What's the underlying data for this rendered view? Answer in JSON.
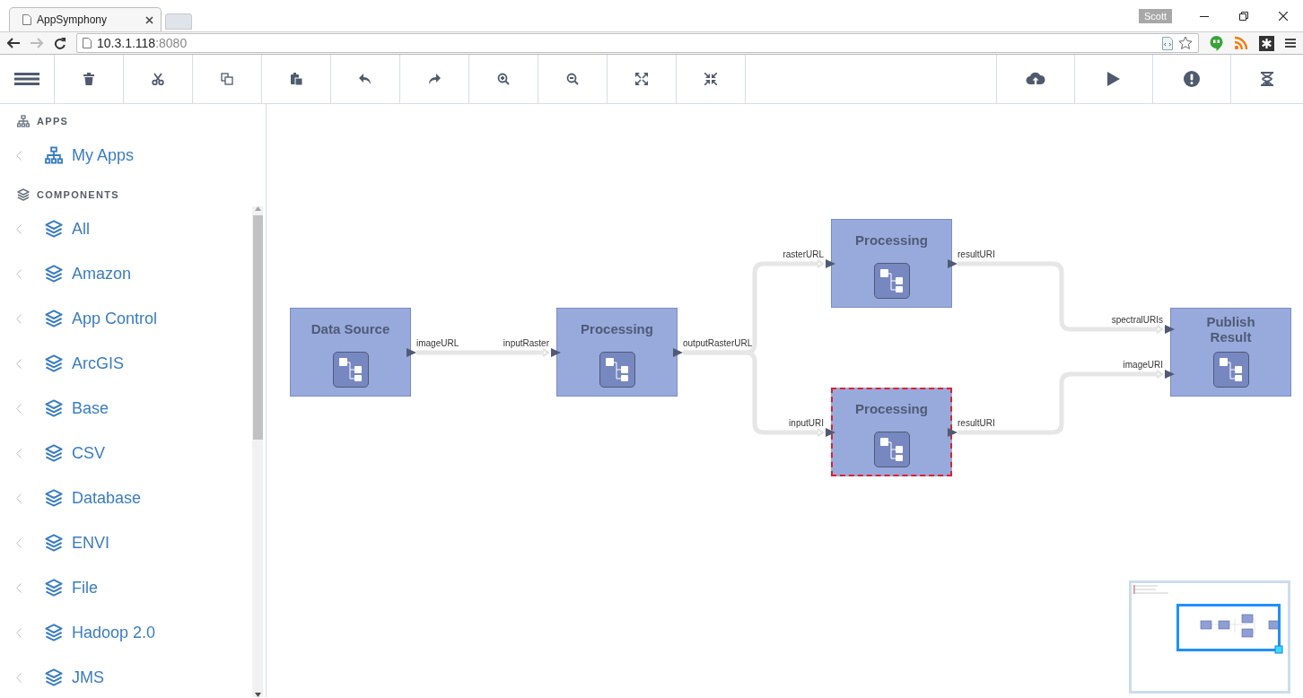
{
  "browser": {
    "tab_title": "AppSymphony",
    "url_host": "10.3.1.118",
    "url_port": ":8080",
    "profile": "Scott"
  },
  "sidebar": {
    "sections": [
      {
        "title": "APPS",
        "items": [
          {
            "label": "My Apps"
          }
        ]
      },
      {
        "title": "COMPONENTS",
        "items": [
          {
            "label": "All"
          },
          {
            "label": "Amazon"
          },
          {
            "label": "App Control"
          },
          {
            "label": "ArcGIS"
          },
          {
            "label": "Base"
          },
          {
            "label": "CSV"
          },
          {
            "label": "Database"
          },
          {
            "label": "ENVI"
          },
          {
            "label": "File"
          },
          {
            "label": "Hadoop 2.0"
          },
          {
            "label": "JMS"
          }
        ]
      }
    ]
  },
  "diagram": {
    "nodes": [
      {
        "title": "Data Source",
        "selected": false,
        "outputs": [
          "imageURL"
        ]
      },
      {
        "title": "Processing",
        "selected": false,
        "inputs": [
          "inputRaster"
        ],
        "outputs": [
          "outputRasterURL"
        ]
      },
      {
        "title": "Processing",
        "selected": false,
        "inputs": [
          "rasterURL"
        ],
        "outputs": [
          "resultURI"
        ]
      },
      {
        "title": "Processing",
        "selected": true,
        "inputs": [
          "inputURI"
        ],
        "outputs": [
          "resultURI"
        ]
      },
      {
        "title": "Publish Result",
        "selected": false,
        "inputs": [
          "spectralURIs",
          "imageURI"
        ]
      }
    ]
  }
}
